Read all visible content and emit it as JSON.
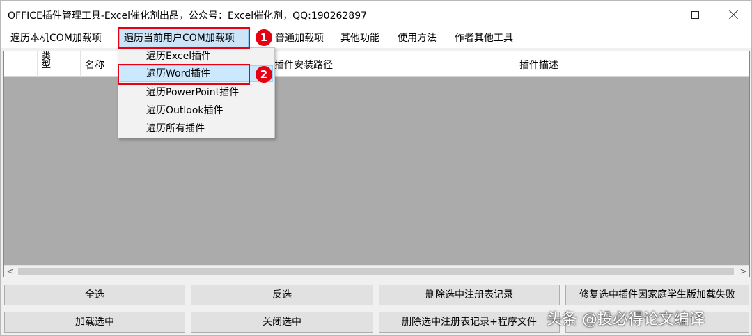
{
  "window": {
    "title": "OFFICE插件管理工具-Excel催化剂出品，公众号：Excel催化剂，QQ:190262897"
  },
  "menu": [
    {
      "label": "遍历本机COM加载项"
    },
    {
      "label": "遍历当前用户COM加载项"
    },
    {
      "label": "普通加载项"
    },
    {
      "label": "其他功能"
    },
    {
      "label": "使用方法"
    },
    {
      "label": "作者其他工具"
    }
  ],
  "dropdown": {
    "items": [
      {
        "label": "遍历Excel插件"
      },
      {
        "label": "遍历Word插件"
      },
      {
        "label": "遍历PowerPoint插件"
      },
      {
        "label": "遍历Outlook插件"
      },
      {
        "label": "遍历所有插件"
      }
    ]
  },
  "grid": {
    "columns": [
      {
        "label": ""
      },
      {
        "label": "类型"
      },
      {
        "label": "名称"
      },
      {
        "label": "插件安装路径"
      },
      {
        "label": "插件描述"
      }
    ]
  },
  "scroll": {
    "left_arrow": "<",
    "right_arrow": ">"
  },
  "buttons": {
    "select_all": "全选",
    "invert": "反选",
    "delete_registry": "删除选中注册表记录",
    "repair": "修复选中插件因家庭学生版加载失败",
    "load_selected": "加载选中",
    "close_selected": "关闭选中",
    "delete_registry_files": "删除选中注册表记录+程序文件"
  },
  "annotations": {
    "step1": "1",
    "step2": "2",
    "color": "#e60012"
  },
  "watermark": "头条 @投必得论文编译"
}
